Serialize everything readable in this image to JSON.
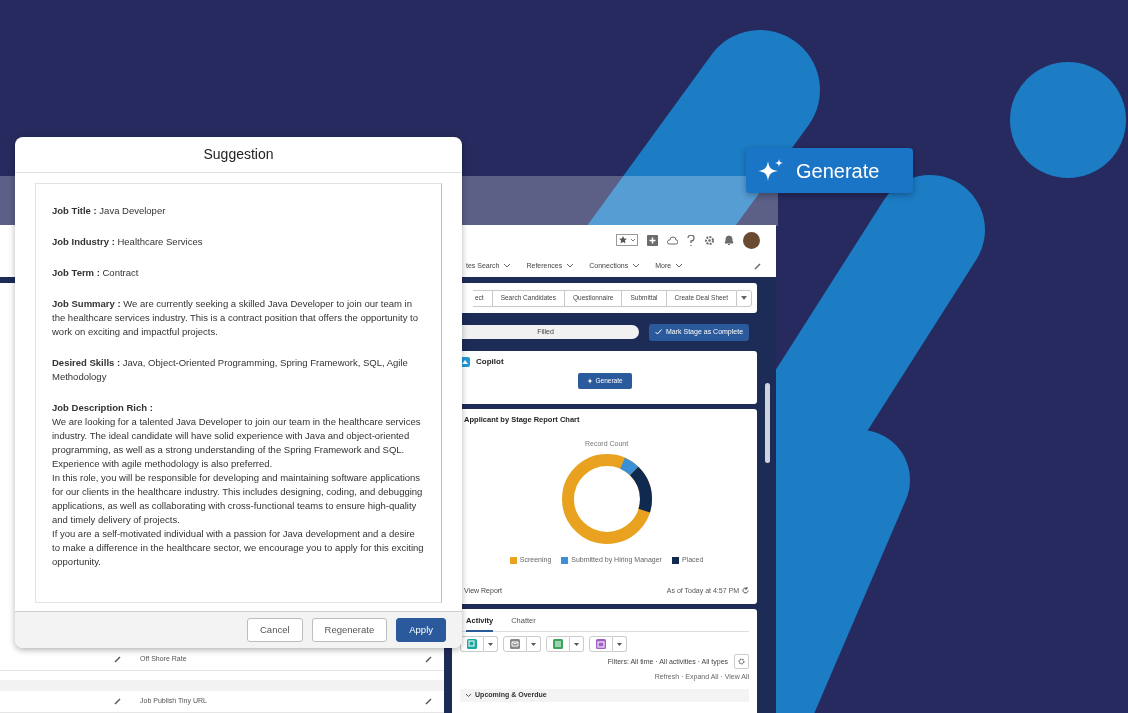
{
  "hero_button": {
    "label": "Generate"
  },
  "app": {
    "nav_tabs": [
      "tes Search",
      "References",
      "Connections",
      "More"
    ],
    "actions": [
      "ect",
      "Search Candidates",
      "Questionnaire",
      "Submittal",
      "Create Deal Sheet"
    ],
    "path": {
      "stage": "Filled",
      "button": "Mark Stage as Complete"
    },
    "copilot": {
      "title": "Copilot",
      "button": "Generate"
    },
    "chart_card": {
      "title": "Applicant by Stage Report Chart",
      "chart_label": "Record Count",
      "legend": [
        {
          "label": "Screening",
          "color": "#e8a21f"
        },
        {
          "label": "Submitted by Hiring Manager",
          "color": "#3a8fd6"
        },
        {
          "label": "Placed",
          "color": "#10294f"
        }
      ],
      "link": "View Report",
      "timestamp": "As of Today at 4:57 PM"
    },
    "activity": {
      "tabs": [
        {
          "label": "Activity",
          "selected": true
        },
        {
          "label": "Chatter",
          "selected": false
        }
      ],
      "filters": "Filters: All time · All activities · All types",
      "links": "Refresh · Expand All · View All",
      "section": "Upcoming & Overdue"
    },
    "fields": [
      {
        "label": "Off Shore Rate"
      },
      {
        "label": "Job Publish Tiny URL"
      }
    ]
  },
  "dialog": {
    "title": "Suggestion",
    "fields": [
      "**Job Title :** Java Developer",
      "**Job Industry :** Healthcare Services",
      "**Job Term :** Contract",
      "**Job Summary :** We are currently seeking a skilled Java Developer to join our team in the healthcare services industry. This is a contract position that offers the opportunity to work on exciting and impactful projects.",
      "**Desired Skills :** Java, Object-Oriented Programming, Spring Framework, SQL, Agile Methodology"
    ],
    "description_label": "Job Description Rich :",
    "description_paragraphs": [
      "We are looking for a talented Java Developer to join our team in the healthcare services industry. The ideal candidate will have solid experience with Java and object-oriented programming, as well as a strong understanding of the Spring Framework and SQL. Experience with agile methodology is also preferred.",
      "In this role, you will be responsible for developing and maintaining software applications for our clients in the healthcare industry. This includes designing, coding, and debugging applications, as well as collaborating with cross-functional teams to ensure high-quality and timely delivery of projects.",
      "If you are a self-motivated individual with a passion for Java development and a desire to make a difference in the healthcare sector, we encourage you to apply for this exciting opportunity."
    ],
    "buttons": [
      {
        "label": "Cancel",
        "kind": "neutral"
      },
      {
        "label": "Regenerate",
        "kind": "neutral"
      },
      {
        "label": "Apply",
        "kind": "brand"
      }
    ]
  }
}
